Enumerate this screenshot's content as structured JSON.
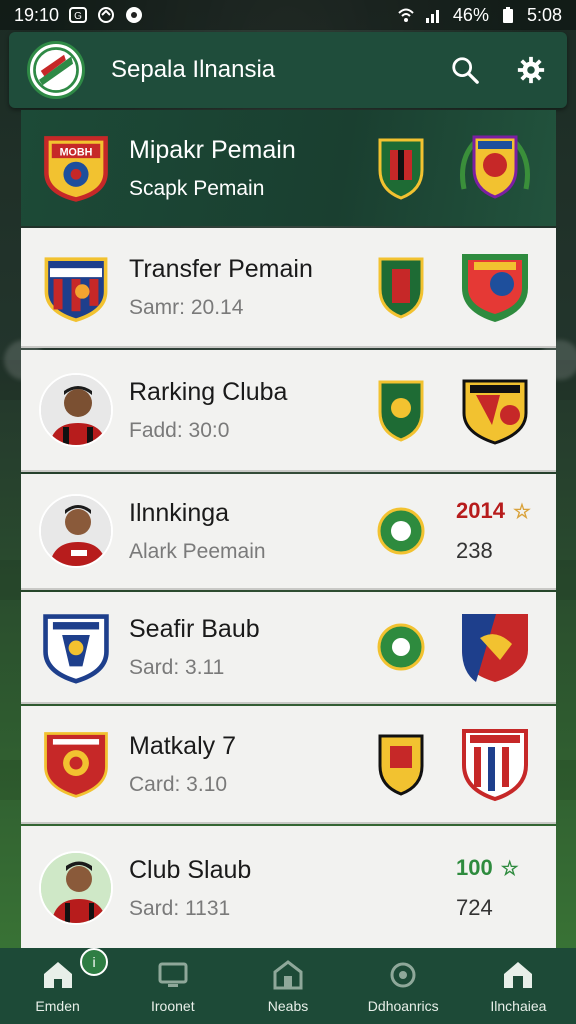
{
  "status_bar": {
    "time": "19:10",
    "battery_percent": "46%",
    "right_time": "5:08"
  },
  "app_bar": {
    "title": "Sepala Ilnansia",
    "search_icon": "search-icon",
    "settings_icon": "gear-icon"
  },
  "rows": [
    {
      "title": "Mipakr Pemain",
      "subtitle": "Scapk Pemain",
      "badge_text": "MOBH",
      "featured": true
    },
    {
      "title": "Transfer Pemain",
      "subtitle": "Samr: 20.14"
    },
    {
      "title": "Rarking Cluba",
      "subtitle": "Fadd: 30:0"
    },
    {
      "title": "Ilnnkinga",
      "subtitle": "Alark Peemain",
      "stat_top": "2014",
      "stat_bottom": "238"
    },
    {
      "title": "Seafir Baub",
      "subtitle": "Sard: 3.11"
    },
    {
      "title": "Matkaly 7",
      "subtitle": "Card: 3.10"
    },
    {
      "title": "Club Slaub",
      "subtitle": "Sard: 1131",
      "stat_top": "100",
      "stat_bottom": "724"
    }
  ],
  "bottom_nav": {
    "items": [
      {
        "label": "Emden",
        "icon": "home-icon",
        "active": true
      },
      {
        "label": "Iroonet",
        "icon": "monitor-icon"
      },
      {
        "label": "Neabs",
        "icon": "building-icon"
      },
      {
        "label": "Ddhoanrics",
        "icon": "gear-badge-icon"
      },
      {
        "label": "Ilnchaiea",
        "icon": "house-icon"
      }
    ]
  },
  "colors": {
    "primary": "#1f4d3b",
    "stat_red": "#b71c1c",
    "stat_green": "#2e8b3e",
    "star_gold": "#d9a23a"
  }
}
